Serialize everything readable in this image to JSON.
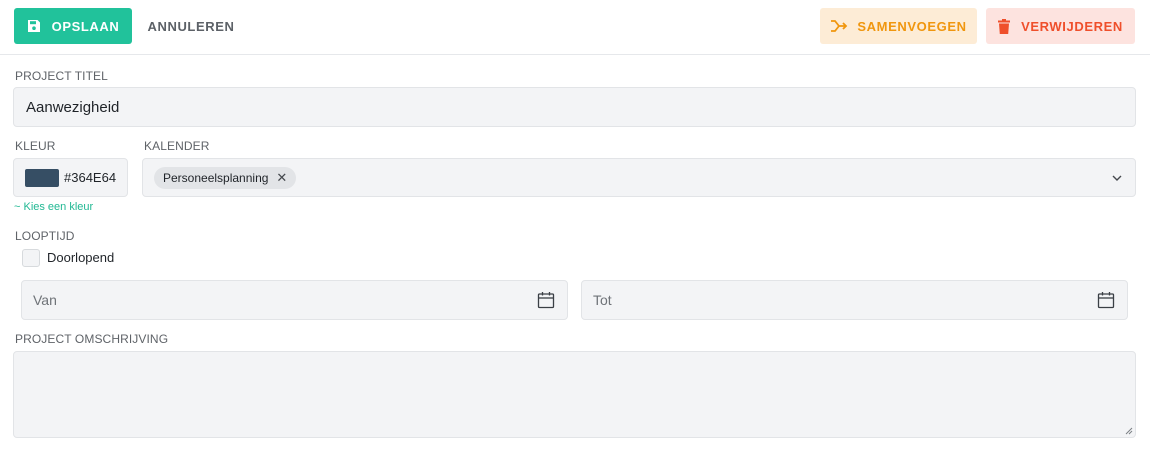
{
  "toolbar": {
    "save_label": "OPSLAAN",
    "cancel_label": "ANNULEREN",
    "merge_label": "SAMENVOEGEN",
    "delete_label": "VERWIJDEREN",
    "save_icon": "floppy-disk-icon",
    "merge_icon": "merge-arrow-icon",
    "delete_icon": "trash-icon"
  },
  "form": {
    "title_label": "PROJECT TITEL",
    "title_value": "Aanwezigheid",
    "color_label": "KLEUR",
    "color_value": "#364E64",
    "color_pick_link": "~ Kies een kleur",
    "calendar_label": "KALENDER",
    "calendar_chips": [
      "Personeelsplanning"
    ],
    "duration_label": "LOOPTIJD",
    "ongoing_label": "Doorlopend",
    "ongoing_checked": false,
    "from_placeholder": "Van",
    "to_placeholder": "Tot",
    "description_label": "PROJECT OMSCHRIJVING",
    "description_value": ""
  },
  "colors": {
    "primary": "#21c29b",
    "merge_bg": "#fdecd6",
    "merge_text": "#f0960e",
    "delete_bg": "#fde3df",
    "delete_text": "#ef4f2b",
    "swatch": "#364E64"
  }
}
